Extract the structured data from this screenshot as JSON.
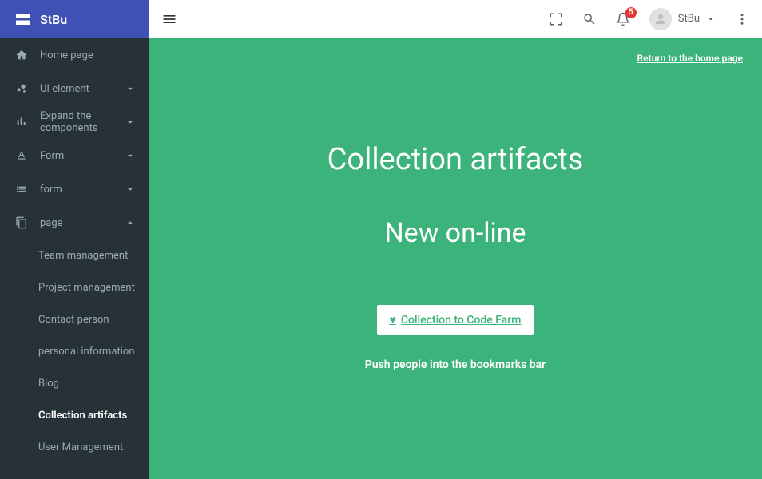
{
  "brand": "StBu",
  "nav": {
    "home": "Home page",
    "ui": "UI element",
    "expand": "Expand the components",
    "formA": "Form",
    "formB": "form",
    "page": "page",
    "subs": {
      "team": "Team management",
      "project": "Project management",
      "contact": "Contact person",
      "personal": "personal information",
      "blog": "Blog",
      "collection": "Collection artifacts",
      "user": "User Management"
    }
  },
  "topbar": {
    "user": "StBu",
    "badge": "5"
  },
  "content": {
    "return": "Return to the home page",
    "title": "Collection artifacts",
    "subtitle": "New on-line",
    "cta": "Collection to Code Farm",
    "push": "Push people into the bookmarks bar"
  }
}
